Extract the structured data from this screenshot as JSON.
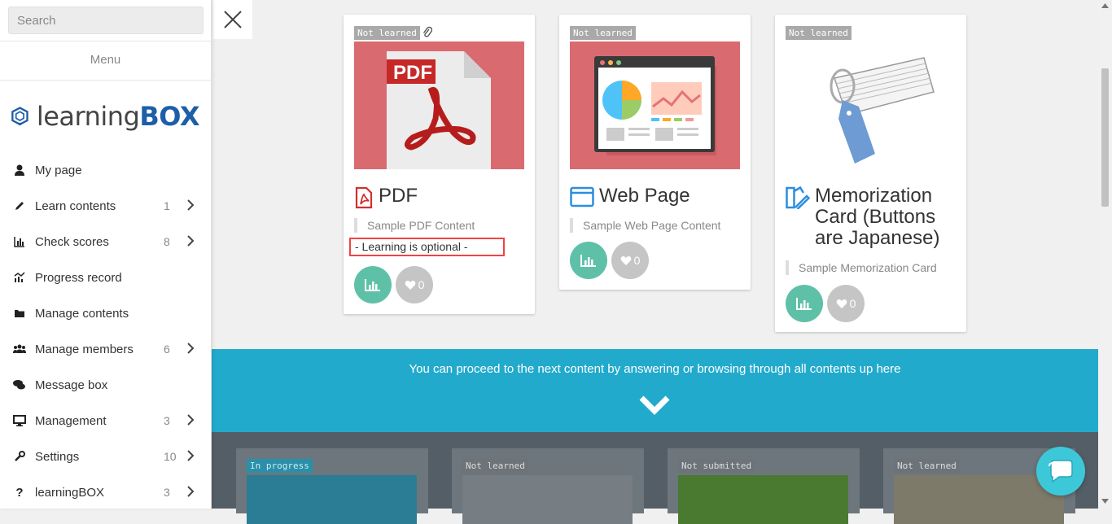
{
  "sidebar": {
    "search_placeholder": "Search",
    "menu_title": "Menu",
    "logo_part1": "learning",
    "logo_part2": "BOX",
    "items": [
      {
        "label": "My page",
        "count": "",
        "icon": "user-icon"
      },
      {
        "label": "Learn contents",
        "count": "1",
        "icon": "pencil-icon"
      },
      {
        "label": "Check scores",
        "count": "8",
        "icon": "bar-chart-icon"
      },
      {
        "label": "Progress record",
        "count": "",
        "icon": "progress-chart-icon"
      },
      {
        "label": "Manage contents",
        "count": "",
        "icon": "folder-icon"
      },
      {
        "label": "Manage members",
        "count": "6",
        "icon": "users-icon"
      },
      {
        "label": "Message box",
        "count": "",
        "icon": "chat-bubbles-icon"
      },
      {
        "label": "Management",
        "count": "3",
        "icon": "monitor-icon"
      },
      {
        "label": "Settings",
        "count": "10",
        "icon": "wrench-icon"
      },
      {
        "label": "learningBOX",
        "count": "3",
        "icon": "question-icon"
      }
    ]
  },
  "cards": [
    {
      "status": "Not learned",
      "title": "PDF",
      "description": "Sample PDF Content",
      "note": "- Learning is optional -",
      "likes": "0"
    },
    {
      "status": "Not learned",
      "title": "Web Page",
      "description": "Sample Web Page Content",
      "likes": "0"
    },
    {
      "status": "Not learned",
      "title": "Memorization Card (Buttons are Japanese)",
      "description": "Sample Memorization Card",
      "likes": "0"
    }
  ],
  "banner": {
    "text": "You can proceed to the next content by answering or browsing through all contents up here"
  },
  "lower_cards": [
    {
      "status": "In progress"
    },
    {
      "status": "Not learned"
    },
    {
      "status": "Not submitted"
    },
    {
      "status": "Not learned"
    }
  ],
  "colors": {
    "accent": "#22aacc",
    "stat_button": "#5fc0a8",
    "highlight_border": "#e44444",
    "brand_blue": "#1e5ea8"
  }
}
